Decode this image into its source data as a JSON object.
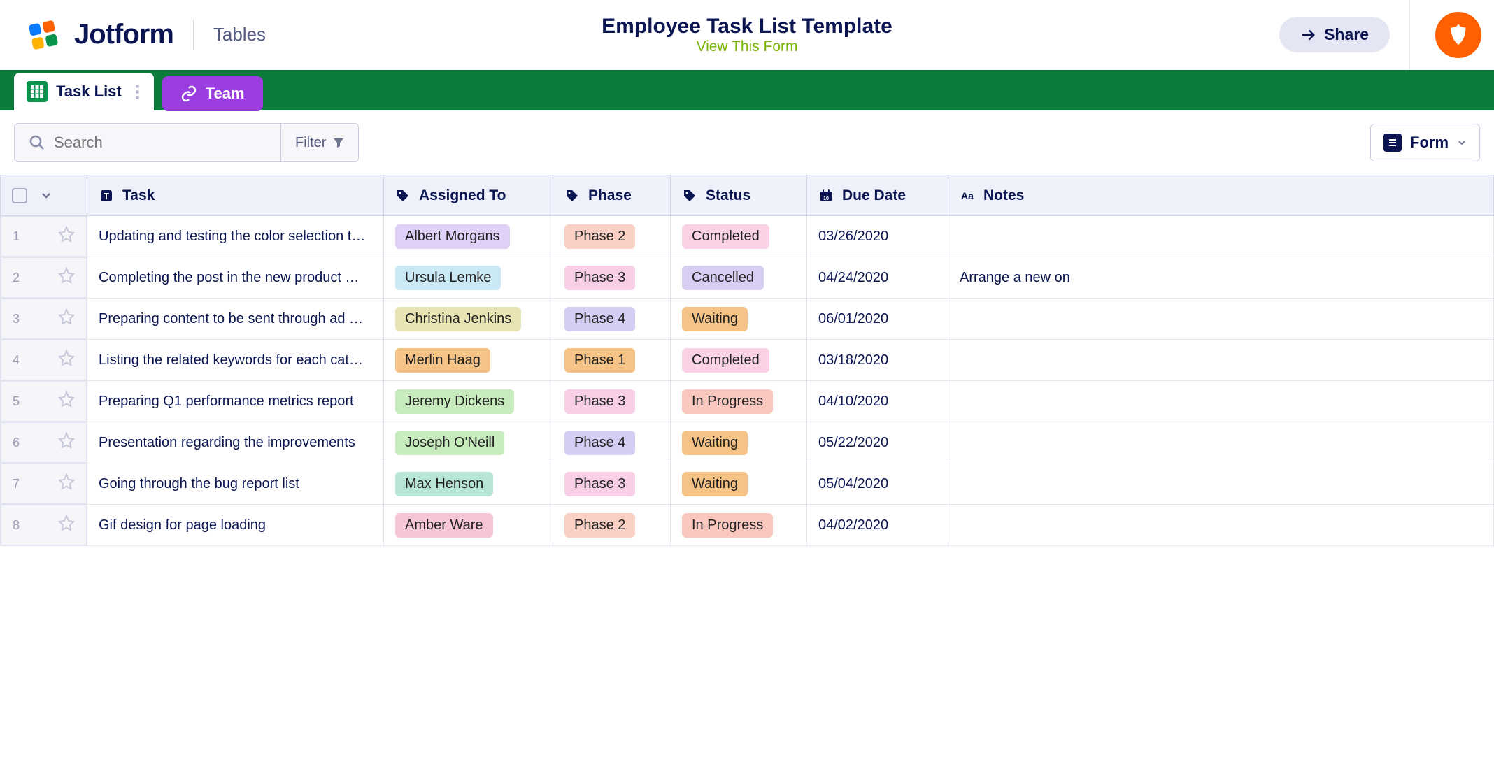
{
  "header": {
    "logo_text": "Jotform",
    "logo_tables": "Tables",
    "title": "Employee Task List Template",
    "view_form": "View This Form",
    "share": "Share"
  },
  "tabs": {
    "task_list": "Task List",
    "team": "Team"
  },
  "toolbar": {
    "search_placeholder": "Search",
    "filter": "Filter",
    "form_button": "Form"
  },
  "columns": {
    "task": "Task",
    "assigned": "Assigned To",
    "phase": "Phase",
    "status": "Status",
    "due": "Due Date",
    "notes": "Notes"
  },
  "pill_colors": {
    "assigned": {
      "Albert Morgans": "#dfd0f7",
      "Ursula Lemke": "#cbe9f5",
      "Christina Jenkins": "#e7e3b3",
      "Merlin Haag": "#f6c386",
      "Jeremy Dickens": "#c7ebbd",
      "Joseph O'Neill": "#c7ebbd",
      "Max Henson": "#b7e6d5",
      "Amber Ware": "#f7c6d6"
    },
    "phase": {
      "Phase 1": "#f6c386",
      "Phase 2": "#fad0c4",
      "Phase 3": "#f8cfe6",
      "Phase 4": "#d5cdf4"
    },
    "status": {
      "Completed": "#fbd1e6",
      "Cancelled": "#d8cdf3",
      "Waiting": "#f6c386",
      "In Progress": "#f9c7bd"
    }
  },
  "rows": [
    {
      "num": "1",
      "task": "Updating and testing the color selection t…",
      "assigned": "Albert Morgans",
      "phase": "Phase 2",
      "status": "Completed",
      "due": "03/26/2020",
      "notes": ""
    },
    {
      "num": "2",
      "task": "Completing the post in the new product …",
      "assigned": "Ursula Lemke",
      "phase": "Phase 3",
      "status": "Cancelled",
      "due": "04/24/2020",
      "notes": "Arrange a new on"
    },
    {
      "num": "3",
      "task": "Preparing content to be sent through ad …",
      "assigned": "Christina Jenkins",
      "phase": "Phase 4",
      "status": "Waiting",
      "due": "06/01/2020",
      "notes": ""
    },
    {
      "num": "4",
      "task": "Listing the related keywords for each cat…",
      "assigned": "Merlin Haag",
      "phase": "Phase 1",
      "status": "Completed",
      "due": "03/18/2020",
      "notes": ""
    },
    {
      "num": "5",
      "task": "Preparing Q1 performance metrics report",
      "assigned": "Jeremy Dickens",
      "phase": "Phase 3",
      "status": "In Progress",
      "due": "04/10/2020",
      "notes": ""
    },
    {
      "num": "6",
      "task": "Presentation regarding the improvements",
      "assigned": "Joseph O'Neill",
      "phase": "Phase 4",
      "status": "Waiting",
      "due": "05/22/2020",
      "notes": ""
    },
    {
      "num": "7",
      "task": "Going through the bug report list",
      "assigned": "Max Henson",
      "phase": "Phase 3",
      "status": "Waiting",
      "due": "05/04/2020",
      "notes": ""
    },
    {
      "num": "8",
      "task": "Gif design for page loading",
      "assigned": "Amber Ware",
      "phase": "Phase 2",
      "status": "In Progress",
      "due": "04/02/2020",
      "notes": ""
    }
  ]
}
